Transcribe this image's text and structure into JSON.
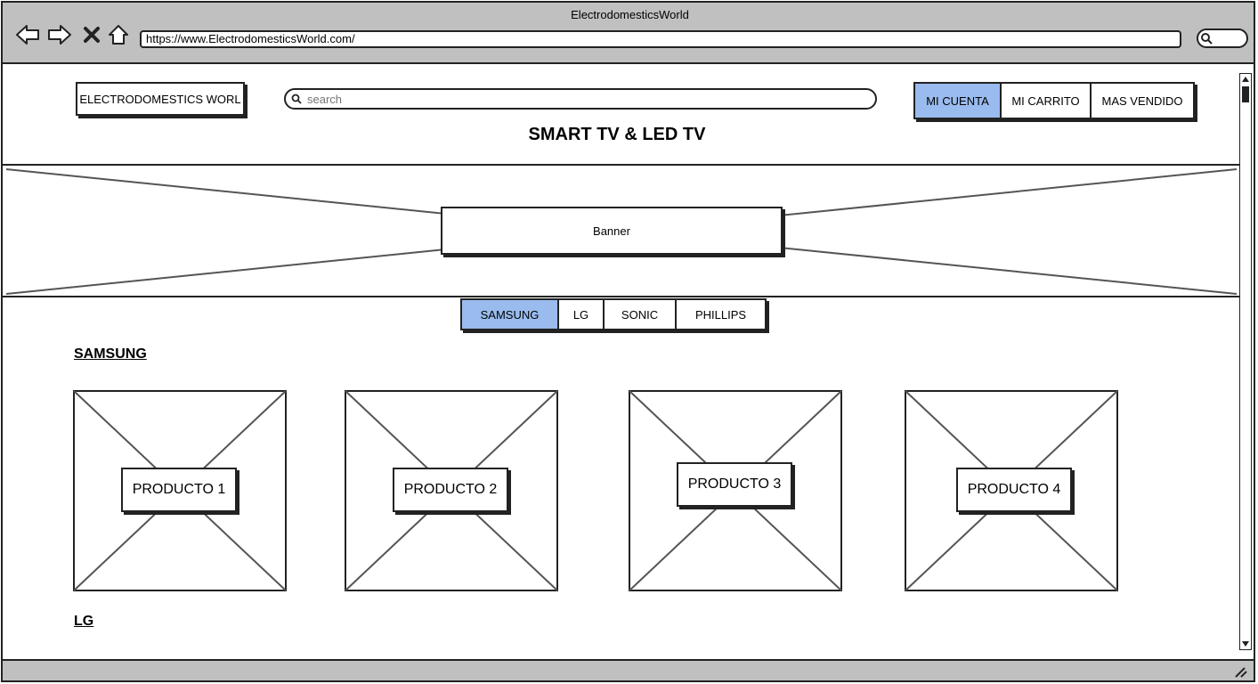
{
  "window": {
    "title": "ElectrodomesticsWorld"
  },
  "browser": {
    "url": "https://www.ElectrodomesticsWorld.com/"
  },
  "header": {
    "logo": "ELECTRODOMESTICS WORL",
    "search_placeholder": "search",
    "nav": [
      {
        "label": "MI CUENTA",
        "active": true
      },
      {
        "label": "MI CARRITO",
        "active": false
      },
      {
        "label": "MAS VENDIDO",
        "active": false
      }
    ]
  },
  "page": {
    "title": "SMART TV & LED TV"
  },
  "banner": {
    "label": "Banner"
  },
  "brand_tabs": [
    {
      "label": "SAMSUNG",
      "active": true
    },
    {
      "label": "LG",
      "active": false
    },
    {
      "label": "SONIC",
      "active": false
    },
    {
      "label": "PHILLIPS",
      "active": false
    }
  ],
  "sections": [
    {
      "title": "SAMSUNG"
    },
    {
      "title": "LG"
    }
  ],
  "products": [
    {
      "label": "PRODUCTO 1"
    },
    {
      "label": "PRODUCTO 2"
    },
    {
      "label": "PRODUCTO 3"
    },
    {
      "label": "PRODUCTO 4"
    }
  ],
  "colors": {
    "accent": "#99bbee",
    "chrome": "#c0c0c0",
    "stroke": "#222222"
  },
  "icons": [
    "back-icon",
    "forward-icon",
    "close-icon",
    "home-icon",
    "search-icon",
    "resize-grip-icon"
  ]
}
